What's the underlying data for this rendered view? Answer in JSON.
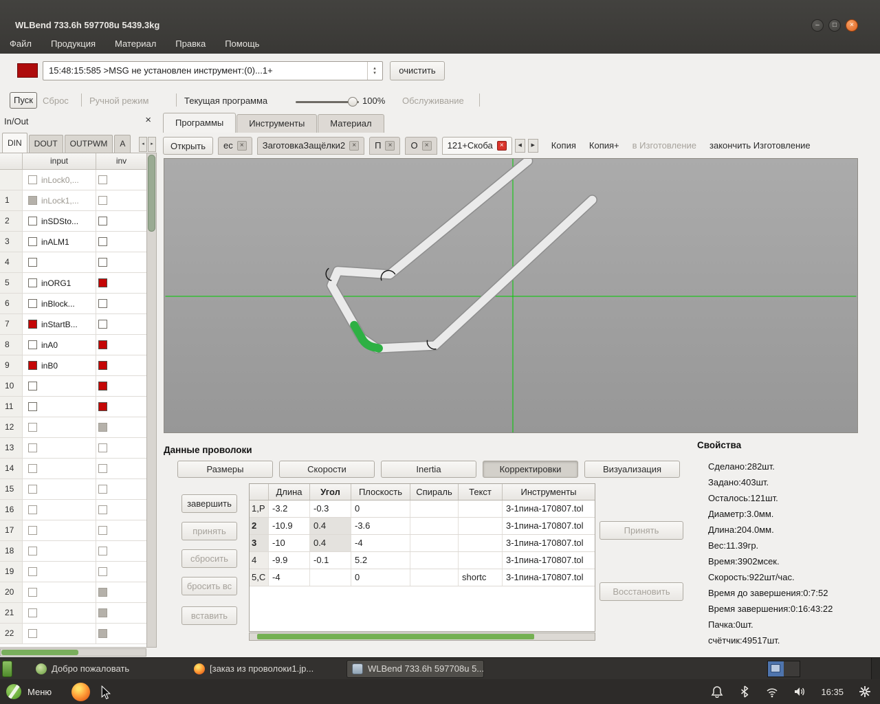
{
  "window": {
    "title": "WLBend 733.6h 597708u 5439.3kg",
    "menu": [
      "Файл",
      "Продукция",
      "Материал",
      "Правка",
      "Помощь"
    ]
  },
  "message_bar": {
    "log_entry": "15:48:15:585 >MSG не установлен инструмент:(0)...1+",
    "clear_label": "очистить"
  },
  "toolbar": {
    "start": "Пуск",
    "reset": "Сброс",
    "manual_mode": "Ручной режим",
    "current_program": "Текущая программа",
    "speed": "100%",
    "service": "Обслуживание"
  },
  "inout": {
    "title": "In/Out",
    "tabs": [
      "DIN",
      "DOUT",
      "OUTPWM",
      "A"
    ],
    "active_tab": "DIN",
    "columns": [
      "input",
      "inv"
    ],
    "rows": [
      {
        "num": "",
        "label": "inLock0,...",
        "input": "off",
        "inv": "off",
        "dim": true
      },
      {
        "num": "1",
        "label": "inLock1,...",
        "input": "gray",
        "inv": "off",
        "dim": true
      },
      {
        "num": "2",
        "label": "inSDSto...",
        "input": "off",
        "inv": "off",
        "dim": false
      },
      {
        "num": "3",
        "label": "inALM1",
        "input": "off",
        "inv": "off",
        "dim": false
      },
      {
        "num": "4",
        "label": "",
        "input": "off",
        "inv": "off",
        "dim": false
      },
      {
        "num": "5",
        "label": "inORG1",
        "input": "off",
        "inv": "red",
        "dim": false
      },
      {
        "num": "6",
        "label": "inBlock...",
        "input": "off",
        "inv": "off",
        "dim": false
      },
      {
        "num": "7",
        "label": "inStartB...",
        "input": "red",
        "inv": "off",
        "dim": false
      },
      {
        "num": "8",
        "label": "inA0",
        "input": "off",
        "inv": "red",
        "dim": false
      },
      {
        "num": "9",
        "label": "inB0",
        "input": "red",
        "inv": "red",
        "dim": false
      },
      {
        "num": "10",
        "label": "",
        "input": "off",
        "inv": "red",
        "dim": false
      },
      {
        "num": "11",
        "label": "",
        "input": "off",
        "inv": "red",
        "dim": false
      },
      {
        "num": "12",
        "label": "",
        "input": "off",
        "inv": "gray",
        "dim": true
      },
      {
        "num": "13",
        "label": "",
        "input": "off",
        "inv": "off",
        "dim": true
      },
      {
        "num": "14",
        "label": "",
        "input": "off",
        "inv": "off",
        "dim": true
      },
      {
        "num": "15",
        "label": "",
        "input": "off",
        "inv": "off",
        "dim": true
      },
      {
        "num": "16",
        "label": "",
        "input": "off",
        "inv": "off",
        "dim": true
      },
      {
        "num": "17",
        "label": "",
        "input": "off",
        "inv": "off",
        "dim": true
      },
      {
        "num": "18",
        "label": "",
        "input": "off",
        "inv": "off",
        "dim": true
      },
      {
        "num": "19",
        "label": "",
        "input": "off",
        "inv": "off",
        "dim": true
      },
      {
        "num": "20",
        "label": "",
        "input": "off",
        "inv": "gray",
        "dim": true
      },
      {
        "num": "21",
        "label": "",
        "input": "off",
        "inv": "gray",
        "dim": true
      },
      {
        "num": "22",
        "label": "",
        "input": "off",
        "inv": "gray",
        "dim": true
      }
    ]
  },
  "main_tabs": {
    "items": [
      "Программы",
      "Инструменты",
      "Материал"
    ],
    "active": "Программы"
  },
  "program_bar": {
    "open_label": "Открыть",
    "tabs": [
      {
        "label": "ес",
        "active": false
      },
      {
        "label": "ЗаготовкаЗащёлки2",
        "active": false
      },
      {
        "label": "П",
        "active": false
      },
      {
        "label": "О",
        "active": false
      },
      {
        "label": "121+Скоба",
        "active": true
      }
    ],
    "actions": [
      {
        "label": "Копия",
        "enabled": true
      },
      {
        "label": "Копия+",
        "enabled": true
      },
      {
        "label": "в Изготовление",
        "enabled": false
      },
      {
        "label": "закончить Изготовление",
        "enabled": true
      }
    ]
  },
  "wire_panel": {
    "title": "Данные проволоки",
    "view_buttons": [
      "Размеры",
      "Скорости",
      "Inertia",
      "Корректировки",
      "Визуализация"
    ],
    "active_view": "Корректировки",
    "left_buttons": [
      {
        "label": "завершить",
        "enabled": true
      },
      {
        "label": "принять",
        "enabled": false
      },
      {
        "label": "сбросить",
        "enabled": false
      },
      {
        "label": "бросить вс",
        "enabled": false
      },
      {
        "label": "вставить",
        "enabled": false
      }
    ],
    "right_buttons": [
      {
        "label": "Принять",
        "enabled": false
      },
      {
        "label": "Восстановить",
        "enabled": false
      }
    ],
    "table": {
      "columns": [
        "",
        "Длина",
        "Угол",
        "Плоскость",
        "Спираль",
        "Текст",
        "Инструменты"
      ],
      "rows": [
        {
          "cells": [
            "1,P",
            "-3.2",
            "-0.3",
            "0",
            "",
            "",
            "3-1пина-170807.tol"
          ],
          "highlight": false
        },
        {
          "cells": [
            "2",
            "-10.9",
            "0.4",
            "-3.6",
            "",
            "",
            "3-1пина-170807.tol"
          ],
          "highlight": true
        },
        {
          "cells": [
            "3",
            "-10",
            "0.4",
            "-4",
            "",
            "",
            "3-1пина-170807.tol"
          ],
          "highlight": true
        },
        {
          "cells": [
            "4",
            "-9.9",
            "-0.1",
            "5.2",
            "",
            "",
            "3-1пина-170807.tol"
          ],
          "highlight": false
        },
        {
          "cells": [
            "5,C",
            "-4",
            "",
            "0",
            "",
            "shortc",
            "3-1пина-170807.tol"
          ],
          "highlight": false
        }
      ]
    }
  },
  "properties": {
    "title": "Свойства",
    "items": [
      "Сделано:282шт.",
      "Задано:403шт.",
      "Осталось:121шт.",
      "Диаметр:3.0мм.",
      "Длина:204.0мм.",
      "Вес:11.39гр.",
      "Время:3902мсек.",
      "Скорость:922шт/час.",
      "Время до завершения:0:7:52",
      "Время завершения:0:16:43:22",
      "Пачка:0шт.",
      "счётчик:49517шт."
    ]
  },
  "taskbar": {
    "windows": [
      {
        "label": "Добро пожаловать",
        "icon": "welcome",
        "active": false
      },
      {
        "label": "[заказ из проволоки1.jp...",
        "icon": "firefox",
        "active": false
      },
      {
        "label": "WLBend 733.6h 597708u 5...",
        "icon": "wlbend",
        "active": true
      }
    ]
  },
  "panel": {
    "menu_label": "Меню",
    "clock": "16:35"
  },
  "colors": {
    "crosshair_green": "#00cc00",
    "signal_red": "#c40606",
    "scrollbar_green": "#74b052"
  }
}
